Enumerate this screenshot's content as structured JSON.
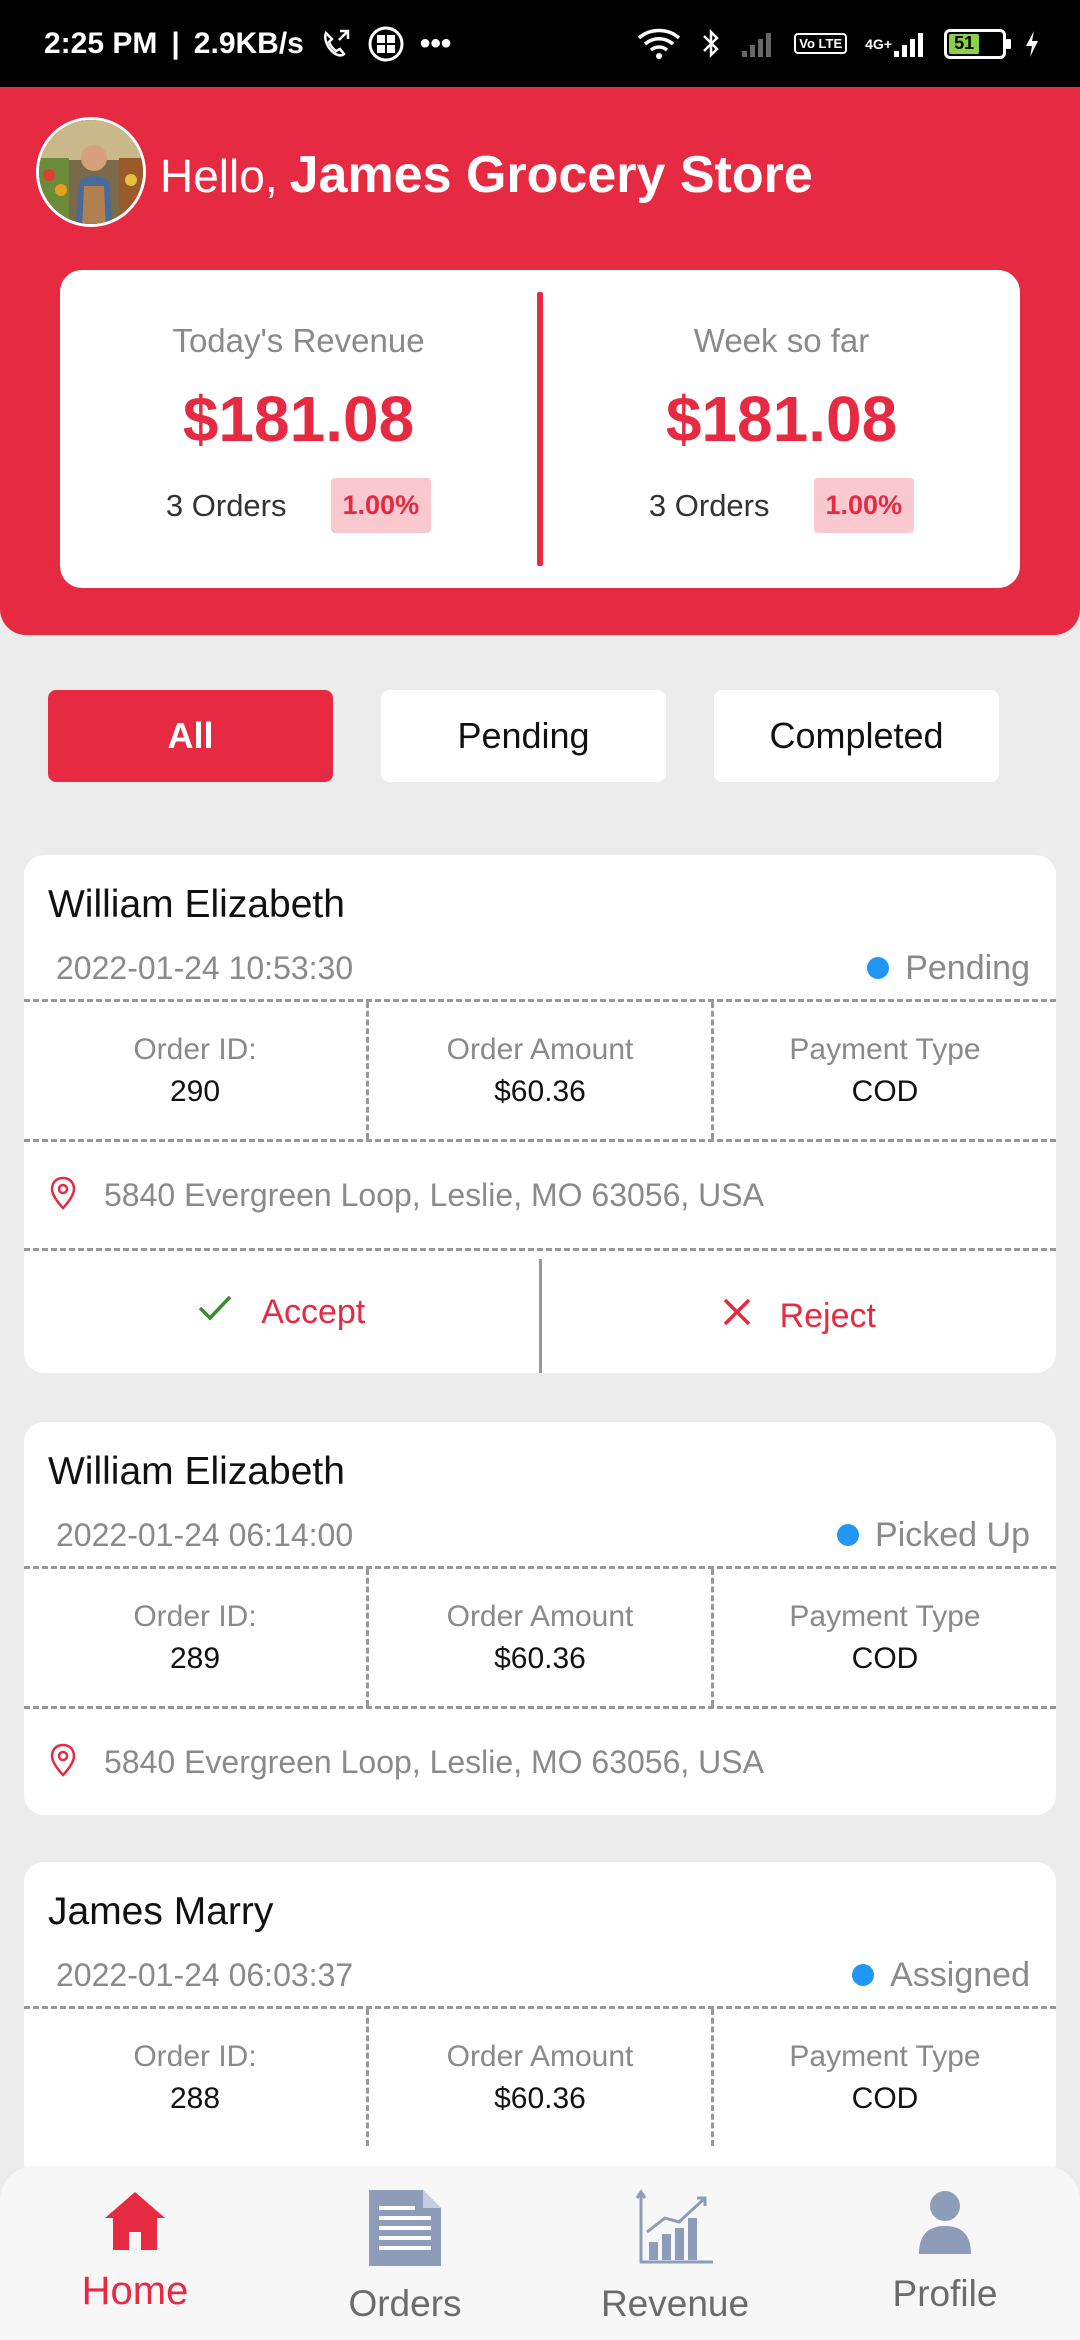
{
  "status_bar": {
    "time": "2:25 PM",
    "speed": "2.9KB/s",
    "volte": "Vo LTE",
    "network": "4G+",
    "battery": "51"
  },
  "header": {
    "greeting": "Hello,",
    "store_name": "James Grocery Store"
  },
  "revenue": {
    "today": {
      "label": "Today's Revenue",
      "value": "$181.08",
      "orders": "3 Orders",
      "pct": "1.00%"
    },
    "week": {
      "label": "Week so far",
      "value": "$181.08",
      "orders": "3 Orders",
      "pct": "1.00%"
    }
  },
  "filters": [
    {
      "label": "All",
      "active": true
    },
    {
      "label": "Pending",
      "active": false
    },
    {
      "label": "Completed",
      "active": false
    }
  ],
  "orders": [
    {
      "customer": "William Elizabeth",
      "datetime": "2022-01-24 10:53:30",
      "status": "Pending",
      "order_id_label": "Order ID:",
      "order_id": "290",
      "amount_label": "Order Amount",
      "amount": "$60.36",
      "payment_label": "Payment Type",
      "payment": "COD",
      "address": "5840 Evergreen Loop, Leslie, MO 63056, USA",
      "accept_label": "Accept",
      "reject_label": "Reject"
    },
    {
      "customer": "William Elizabeth",
      "datetime": "2022-01-24 06:14:00",
      "status": "Picked Up",
      "order_id_label": "Order ID:",
      "order_id": "289",
      "amount_label": "Order Amount",
      "amount": "$60.36",
      "payment_label": "Payment Type",
      "payment": "COD",
      "address": "5840 Evergreen Loop, Leslie, MO 63056, USA"
    },
    {
      "customer": "James Marry",
      "datetime": "2022-01-24 06:03:37",
      "status": "Assigned",
      "order_id_label": "Order ID:",
      "order_id": "288",
      "amount_label": "Order Amount",
      "amount": "$60.36",
      "payment_label": "Payment Type",
      "payment": "COD"
    }
  ],
  "nav": [
    {
      "label": "Home",
      "icon": "home-icon",
      "active": true
    },
    {
      "label": "Orders",
      "icon": "document-icon",
      "active": false
    },
    {
      "label": "Revenue",
      "icon": "bar-chart-icon",
      "active": false
    },
    {
      "label": "Profile",
      "icon": "user-icon",
      "active": false
    }
  ],
  "colors": {
    "brand": "#e52a42",
    "status_dot": "#2196f3",
    "accept_check": "#3a8a2e"
  }
}
